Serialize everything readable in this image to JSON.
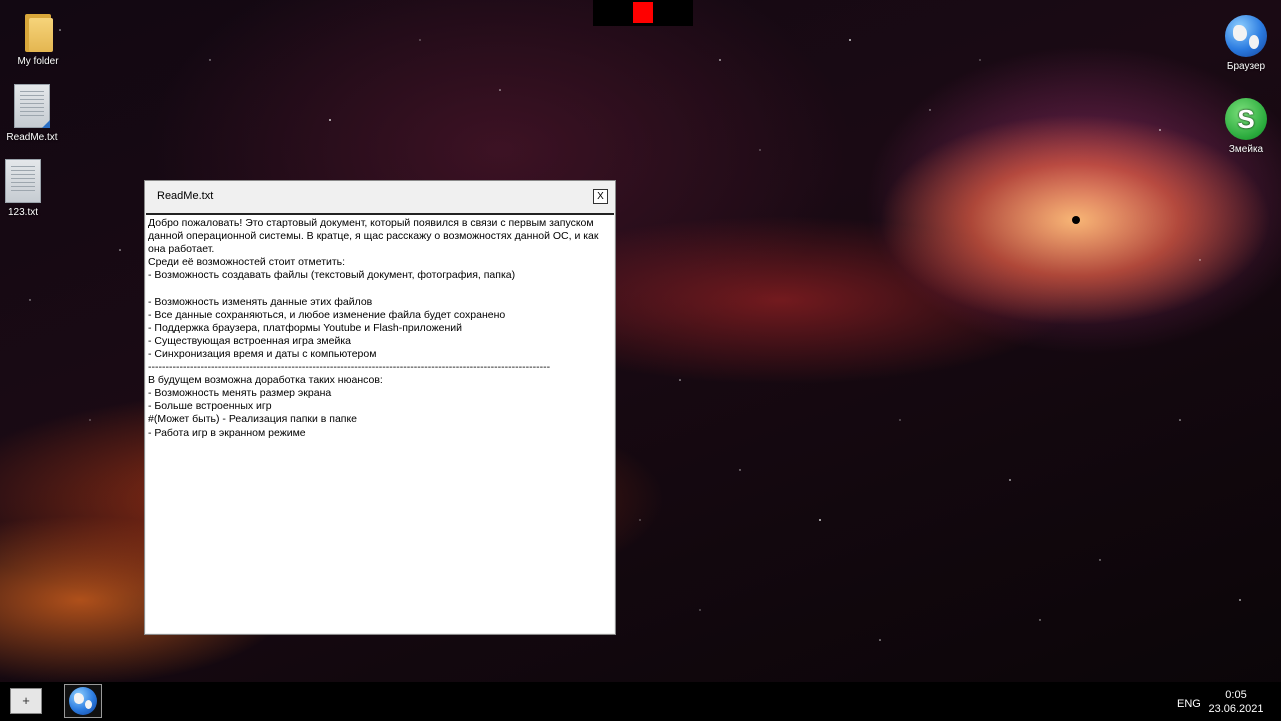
{
  "desktop": {
    "left_icons": [
      {
        "label": "My folder",
        "icon": "folder-icon"
      },
      {
        "label": "ReadMe.txt",
        "icon": "text-document-icon"
      },
      {
        "label": "123.txt",
        "icon": "text-document-icon"
      }
    ],
    "right_icons": [
      {
        "label": "Браузер",
        "icon": "globe-icon"
      },
      {
        "label": "Змейка",
        "icon": "snake-icon"
      }
    ]
  },
  "top_indicator": {
    "color": "#ff0000"
  },
  "window": {
    "title": "ReadMe.txt",
    "close_label": "X",
    "content": "Добро пожаловать! Это стартовый документ, который появился в связи с первым запуском данной операционной системы. В кратце, я щас расскажу о возможностях данной ОС, и как она работает.\nСреди её возможностей стоит отметить:\n- Возможность создавать файлы (текстовый документ, фотография, папка)\n\n- Возможность изменять данные этих файлов\n- Все данные сохраняються, и любое изменение файла будет сохранено\n- Поддержка браузера, платформы Youtube и Flash-приложений\n- Существующая встроенная игра змейка\n- Синхронизация время и даты с компьютером\n-------------------------------------------------------------------------------------------------------------------\nВ будущем возможна доработка таких нюансов:\n- Возможность менять размер экрана\n- Больше встроенных игр\n#(Может быть) - Реализация папки в папке\n- Работа игр в экранном режиме"
  },
  "taskbar": {
    "start_label": "+",
    "pinned_app_icon": "globe-icon",
    "language": "ENG",
    "time": "0:05",
    "date": "23.06.2021"
  }
}
